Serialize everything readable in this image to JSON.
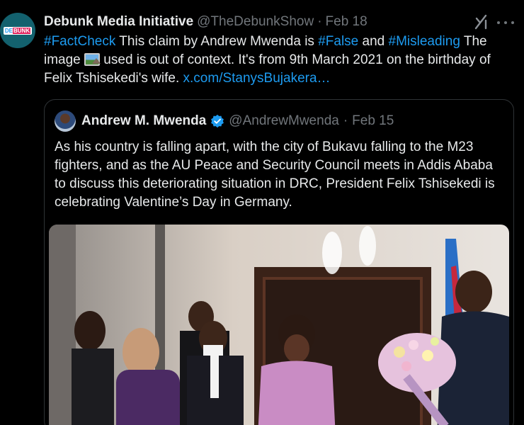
{
  "tweet": {
    "avatar_logo": {
      "part1": "DE",
      "part2": "BUNK"
    },
    "display_name": "Debunk Media Initiative",
    "handle": "@TheDebunkShow",
    "separator": "·",
    "date": "Feb 18",
    "body": {
      "hashtag1": "#FactCheck",
      "text1": " This claim by Andrew Mwenda is ",
      "hashtag2": "#False",
      "text2": " and ",
      "hashtag3": "#Misleading",
      "text3": " The image ",
      "text4": " used is out of context. It's from 9th March 2021 on the birthday of Felix Tshisekedi's wife. ",
      "link": "x.com/StanysBujakera…"
    }
  },
  "quote": {
    "display_name": "Andrew M. Mwenda",
    "handle": "@AndrewMwenda",
    "separator": "·",
    "date": "Feb 15",
    "text": "As his country is falling apart, with the city of Bukavu falling to the M23 fighters, and as the AU Peace and Security Council meets in Addis Ababa to discuss this deteriorating situation in DRC, President Felix Tshisekedi is celebrating Valentine’s Day in Germany."
  },
  "colors": {
    "background": "#000000",
    "text": "#e7e9ea",
    "secondary": "#71767b",
    "accent": "#1d9bf0",
    "border": "#2f3336"
  },
  "icons": {
    "grok": "grok-icon",
    "more": "more-icon",
    "verified": "verified-badge-icon",
    "image_emoji": "framed-picture-icon"
  }
}
